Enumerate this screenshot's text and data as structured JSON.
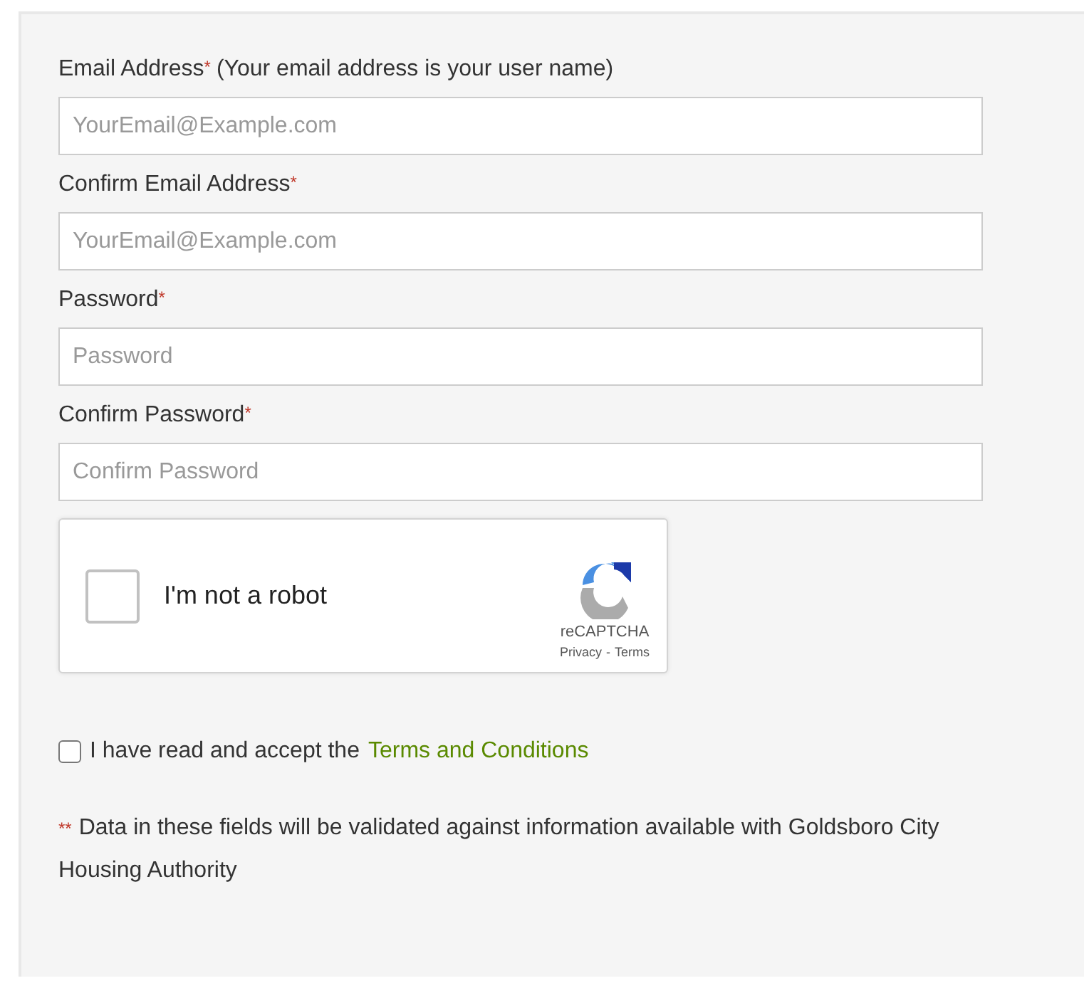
{
  "fields": [
    {
      "label": "Email Address",
      "required_mark": "*",
      "hint": "(Your email address is your user name)",
      "placeholder": "YourEmail@Example.com"
    },
    {
      "label": "Confirm Email Address",
      "required_mark": "*",
      "placeholder": "YourEmail@Example.com"
    },
    {
      "label": "Password",
      "required_mark": "*",
      "placeholder": "Password"
    },
    {
      "label": "Confirm Password",
      "required_mark": "*",
      "placeholder": "Confirm Password"
    }
  ],
  "captcha": {
    "label": "I'm not a robot",
    "checked": false,
    "brand": "reCAPTCHA",
    "privacy": "Privacy",
    "separator": "-",
    "terms": "Terms"
  },
  "terms": {
    "checked": false,
    "text": "I have read and accept the",
    "link": "Terms and Conditions"
  },
  "note": {
    "mark": "**",
    "text": "Data in these fields will be validated against information available with Goldsboro City Housing Authority"
  }
}
